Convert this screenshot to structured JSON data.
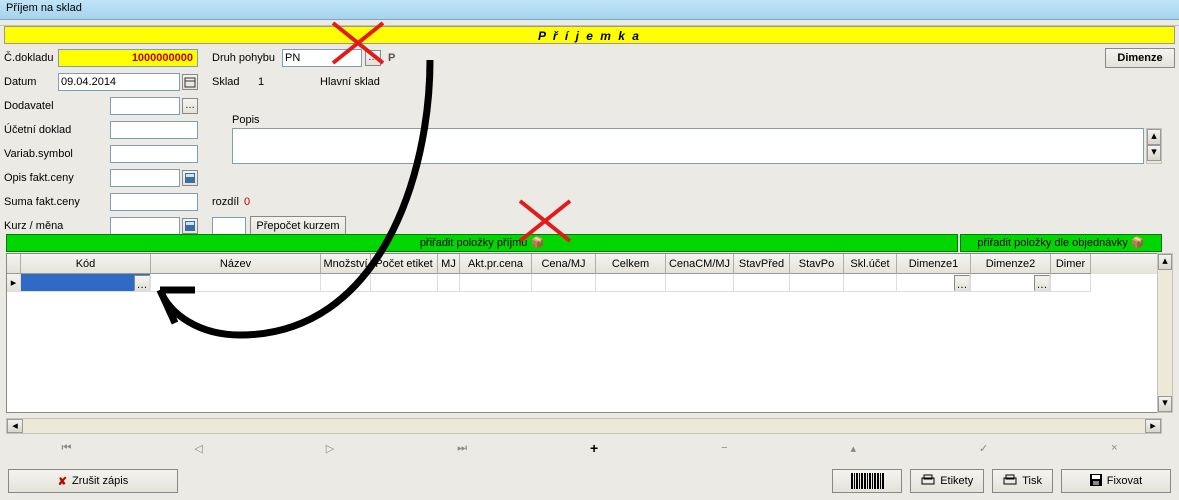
{
  "window": {
    "title": "Příjem na sklad"
  },
  "header": {
    "title": "P ř í j e m k a"
  },
  "labels": {
    "c_dokladu": "Č.dokladu",
    "datum": "Datum",
    "dodavatel": "Dodavatel",
    "ucetni_doklad": "Účetní doklad",
    "variab_symbol": "Variab.symbol",
    "opis_fakt_ceny": "Opis fakt.ceny",
    "suma_fakt_ceny": "Suma fakt.ceny",
    "kurz_mena": "Kurz / měna",
    "druh_pohybu": "Druh pohybu",
    "sklad": "Sklad",
    "popis": "Popis",
    "rozdil": "rozdíl",
    "sklad_no": "1",
    "sklad_name": "Hlavní sklad",
    "druh_suffix": "P"
  },
  "values": {
    "c_dokladu": "1000000000",
    "datum": "09.04.2014",
    "druh_pohybu": "PN",
    "rozdil": "0"
  },
  "buttons": {
    "dimenze": "Dimenze",
    "prepocet": "Přepočet kurzem",
    "priradit_prijmu": "přiřadit položky příjmu",
    "priradit_obj": "přiřadit položky dle objednávky",
    "zrusit": "Zrušit zápis",
    "etikety": "Etikety",
    "tisk": "Tisk",
    "fixovat": "Fixovat"
  },
  "grid": {
    "columns": [
      "Kód",
      "Název",
      "Množství",
      "Počet etiket",
      "MJ",
      "Akt.pr.cena",
      "Cena/MJ",
      "Celkem",
      "CenaCM/MJ",
      "StavPřed",
      "StavPo",
      "Skl.účet",
      "Dimenze1",
      "Dimenze2",
      "Dimer"
    ],
    "widths": [
      130,
      170,
      50,
      67,
      22,
      72,
      64,
      70,
      68,
      56,
      54,
      53,
      74,
      80,
      40
    ]
  }
}
